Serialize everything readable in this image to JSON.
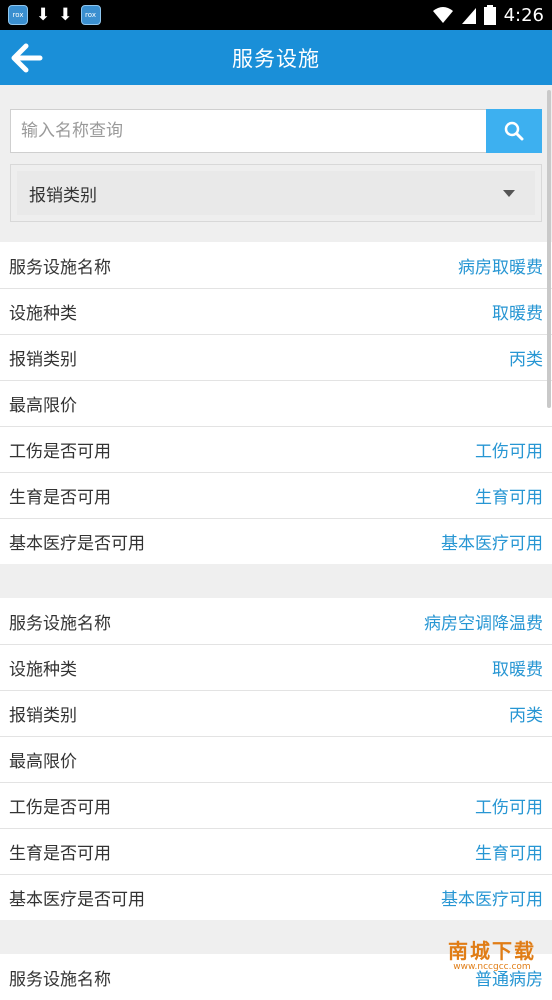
{
  "status_bar": {
    "time": "4:26",
    "app_icon_text": "rox"
  },
  "header": {
    "title": "服务设施"
  },
  "search": {
    "placeholder": "输入名称查询",
    "value": ""
  },
  "filter": {
    "selected": "报销类别"
  },
  "facilities": [
    {
      "rows": [
        {
          "label": "服务设施名称",
          "value": "病房取暖费"
        },
        {
          "label": "设施种类",
          "value": "取暖费"
        },
        {
          "label": "报销类别",
          "value": "丙类"
        },
        {
          "label": "最高限价",
          "value": ""
        },
        {
          "label": "工伤是否可用",
          "value": "工伤可用"
        },
        {
          "label": "生育是否可用",
          "value": "生育可用"
        },
        {
          "label": "基本医疗是否可用",
          "value": "基本医疗可用"
        }
      ]
    },
    {
      "rows": [
        {
          "label": "服务设施名称",
          "value": "病房空调降温费"
        },
        {
          "label": "设施种类",
          "value": "取暖费"
        },
        {
          "label": "报销类别",
          "value": "丙类"
        },
        {
          "label": "最高限价",
          "value": ""
        },
        {
          "label": "工伤是否可用",
          "value": "工伤可用"
        },
        {
          "label": "生育是否可用",
          "value": "生育可用"
        },
        {
          "label": "基本医疗是否可用",
          "value": "基本医疗可用"
        }
      ]
    },
    {
      "rows": [
        {
          "label": "服务设施名称",
          "value": "普通病房"
        }
      ]
    }
  ],
  "watermark": {
    "main": "南城下载",
    "sub": "www.nccgcc.com"
  },
  "colors": {
    "accent": "#1a8fd8",
    "value_text": "#2796d3",
    "search_button": "#3db0f0"
  }
}
